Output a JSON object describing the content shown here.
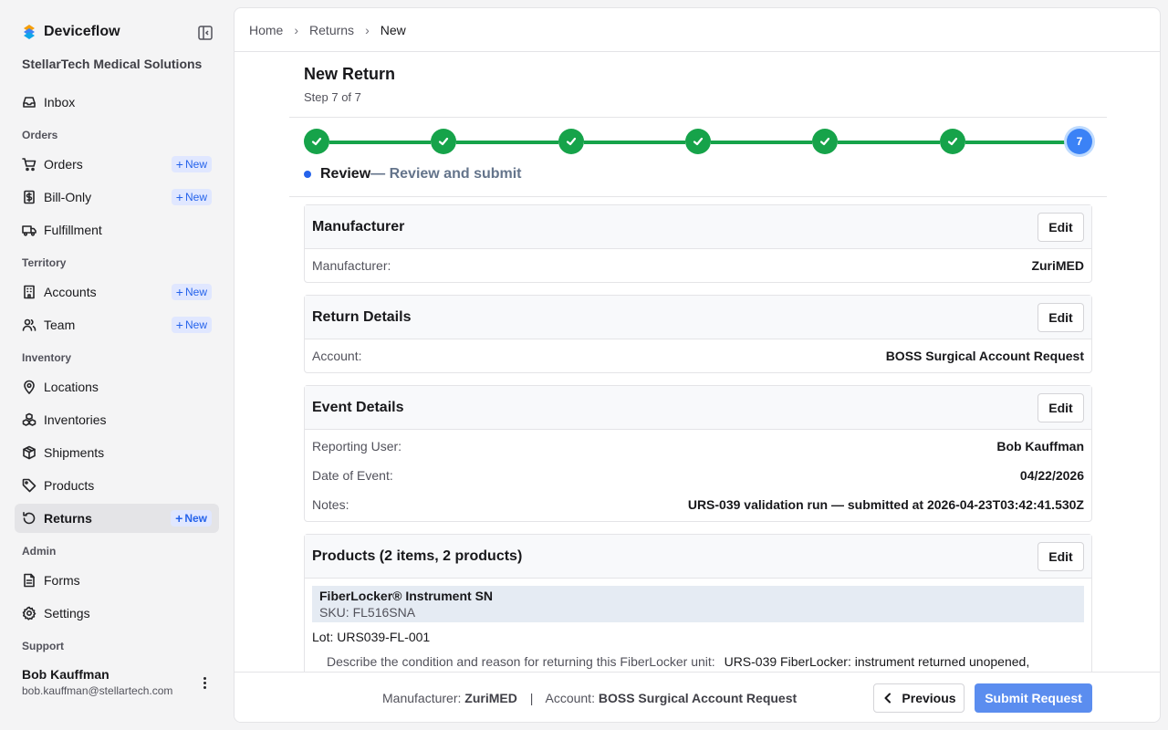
{
  "app": {
    "name": "Deviceflow",
    "org": "StellarTech Medical Solutions"
  },
  "sidebar": {
    "new_label": "New",
    "inbox": "Inbox",
    "sections": {
      "orders": "Orders",
      "territory": "Territory",
      "inventory": "Inventory",
      "admin": "Admin",
      "support": "Support"
    },
    "items": {
      "orders": "Orders",
      "bill_only": "Bill-Only",
      "fulfillment": "Fulfillment",
      "accounts": "Accounts",
      "team": "Team",
      "locations": "Locations",
      "inventories": "Inventories",
      "shipments": "Shipments",
      "products": "Products",
      "returns": "Returns",
      "forms": "Forms",
      "settings": "Settings"
    },
    "active": "returns"
  },
  "user": {
    "name": "Bob Kauffman",
    "email": "bob.kauffman@stellartech.com"
  },
  "breadcrumb": [
    "Home",
    "Returns",
    "New"
  ],
  "page": {
    "title": "New Return",
    "step_text": "Step 7 of 7"
  },
  "stepper": {
    "total": 7,
    "current": 7,
    "current_label": "7",
    "current_name": "Review",
    "current_desc": "— Review and submit",
    "completed_color": "#16a34a",
    "current_color": "#3b82f6"
  },
  "edit_label": "Edit",
  "cards": {
    "manufacturer": {
      "title": "Manufacturer",
      "label": "Manufacturer:",
      "value": "ZuriMED"
    },
    "return_details": {
      "title": "Return Details",
      "label": "Account:",
      "value": "BOSS Surgical Account Request"
    },
    "event_details": {
      "title": "Event Details",
      "rows": [
        {
          "label": "Reporting User:",
          "value": "Bob Kauffman"
        },
        {
          "label": "Date of Event:",
          "value": "04/22/2026"
        },
        {
          "label": "Notes:",
          "value": "URS-039 validation run — submitted at 2026-04-23T03:42:41.530Z"
        }
      ]
    },
    "products": {
      "title": "Products (2 items, 2 products)",
      "product_name": "FiberLocker® Instrument SN",
      "sku": "SKU: FL516SNA",
      "lot_label": "Lot:",
      "lot_value": "URS039-FL-001",
      "describe_label": "Describe the condition and reason for returning this FiberLocker unit:",
      "describe_value": "URS-039 FiberLocker: instrument returned unopened,"
    }
  },
  "footer": {
    "manufacturer_label": "Manufacturer:",
    "manufacturer_value": "ZuriMED",
    "divider": "|",
    "account_label": "Account:",
    "account_value": "BOSS Surgical Account Request",
    "previous": "Previous",
    "submit": "Submit Request"
  }
}
